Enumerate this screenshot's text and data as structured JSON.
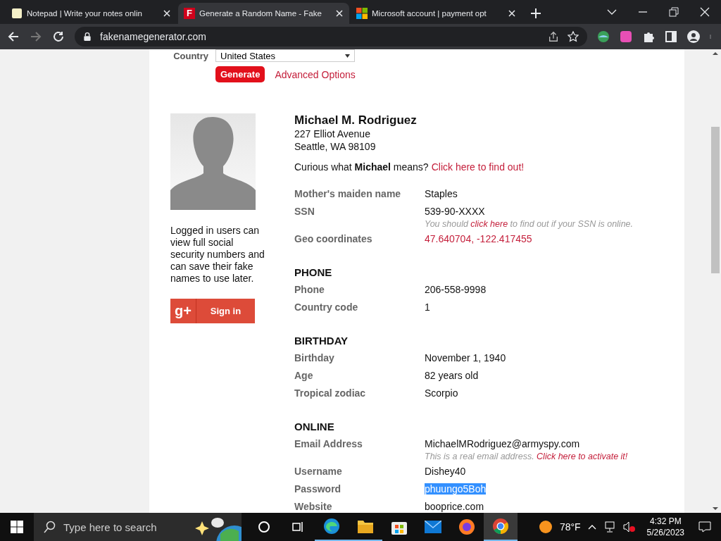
{
  "browser": {
    "tabs": [
      {
        "title": "Notepad | Write your notes onlin",
        "kind": "note",
        "selected": false
      },
      {
        "title": "Generate a Random Name - Fake",
        "kind": "f",
        "favicon_text": "F",
        "selected": true
      },
      {
        "title": "Microsoft account | payment opt",
        "kind": "ms",
        "selected": false
      }
    ],
    "url": "fakenamegenerator.com"
  },
  "form": {
    "country_label": "Country",
    "country_value": "United States",
    "generate": "Generate",
    "advanced": "Advanced Options"
  },
  "sidebar": {
    "note": "Logged in users can view full social security numbers and can save their fake names to use later.",
    "signin_logo": "g+",
    "signin": "Sign in"
  },
  "identity": {
    "name": "Michael M. Rodriguez",
    "address": [
      "227 Elliot Avenue",
      "Seattle, WA 98109"
    ],
    "curious": "Curious what **Michael** means?",
    "curious_link": "Click here to find out!"
  },
  "sections": [
    {
      "rows": [
        {
          "label": "Mother's maiden name",
          "value": "Staples",
          "link": false,
          "highlighted": false
        },
        {
          "label": "SSN",
          "value": "539-90-XXXX",
          "link": false,
          "highlighted": false,
          "note": {
            "before": "You should ",
            "link": "click here",
            "after": " to find out if your SSN is online."
          }
        },
        {
          "label": "Geo coordinates",
          "value": "47.640704, -122.417455",
          "link": true,
          "highlighted": false
        }
      ]
    },
    {
      "heading": "PHONE",
      "rows": [
        {
          "label": "Phone",
          "value": "206-558-9998",
          "link": false,
          "highlighted": false
        },
        {
          "label": "Country code",
          "value": "1",
          "link": false,
          "highlighted": false
        }
      ]
    },
    {
      "heading": "BIRTHDAY",
      "rows": [
        {
          "label": "Birthday",
          "value": "November 1, 1940",
          "link": false,
          "highlighted": false
        },
        {
          "label": "Age",
          "value": "82 years old",
          "link": false,
          "highlighted": false
        },
        {
          "label": "Tropical zodiac",
          "value": "Scorpio",
          "link": false,
          "highlighted": false
        }
      ]
    },
    {
      "heading": "ONLINE",
      "rows": [
        {
          "label": "Email Address",
          "value": "MichaelMRodriguez@armyspy.com",
          "link": false,
          "highlighted": false,
          "note": {
            "before": "This is a real email address. ",
            "link": "Click here to activate it!"
          }
        },
        {
          "label": "Username",
          "value": "Dishey40",
          "link": false,
          "highlighted": false
        },
        {
          "label": "Password",
          "value": "phuungo5Boh",
          "link": false,
          "highlighted": true
        },
        {
          "label": "Website",
          "value": "booprice.com",
          "link": false,
          "highlighted": false
        }
      ]
    }
  ],
  "taskbar": {
    "search_placeholder": "Type here to search",
    "apps": [
      {
        "kind": "cortana",
        "running": false,
        "selected": false
      },
      {
        "kind": "taskview",
        "running": false,
        "selected": false
      },
      {
        "kind": "edge",
        "running": true,
        "selected": false
      },
      {
        "kind": "explorer",
        "running": true,
        "selected": false
      },
      {
        "kind": "store",
        "running": false,
        "selected": false
      },
      {
        "kind": "mail",
        "running": false,
        "selected": false
      },
      {
        "kind": "firefox",
        "running": false,
        "selected": false
      },
      {
        "kind": "chrome",
        "running": true,
        "selected": true
      }
    ],
    "weather": "78°F",
    "time": "4:32 PM",
    "date": "5/26/2023"
  }
}
